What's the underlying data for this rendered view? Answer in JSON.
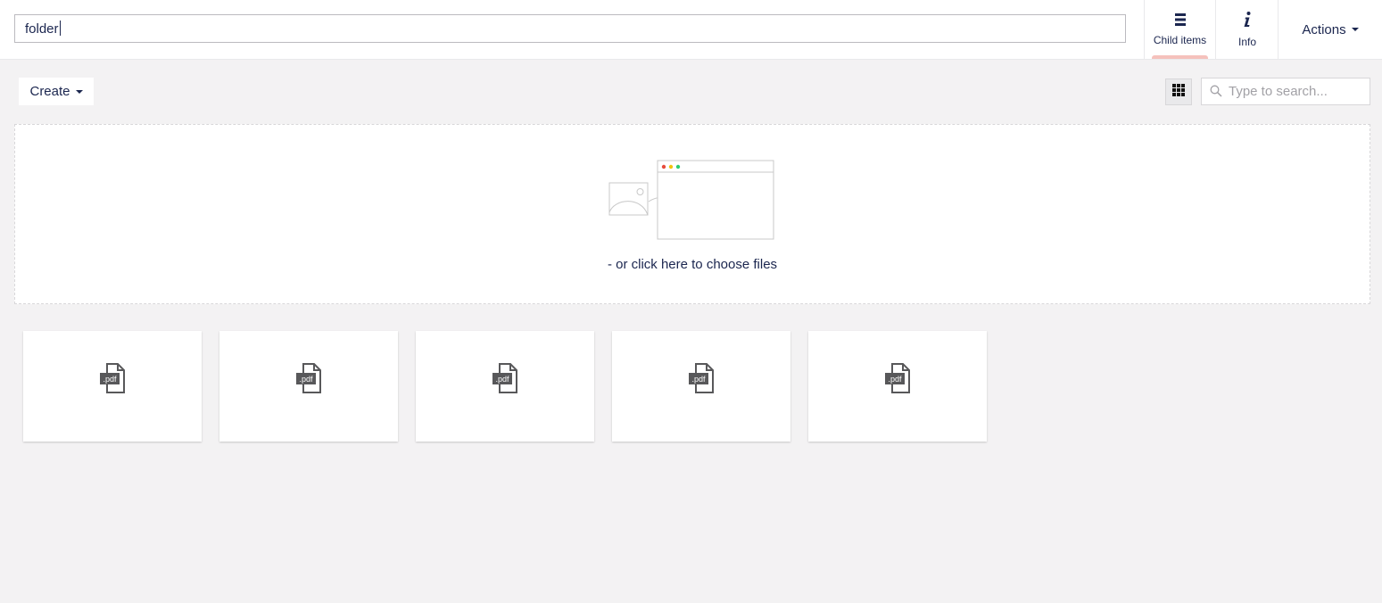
{
  "header": {
    "name_value": "folder",
    "child_items_label": "Child items",
    "info_label": "Info",
    "actions_label": "Actions"
  },
  "toolbar": {
    "create_label": "Create",
    "search_placeholder": "Type to search..."
  },
  "dropzone": {
    "text": "- or click here to choose files"
  },
  "files": [
    {
      "ext": ".pdf"
    },
    {
      "ext": ".pdf"
    },
    {
      "ext": ".pdf"
    },
    {
      "ext": ".pdf"
    },
    {
      "ext": ".pdf"
    }
  ],
  "icons": {
    "child_items": "list-icon",
    "info": "info-icon",
    "grid": "grid-view-icon",
    "search": "search-icon",
    "file": "pdf-file-icon"
  },
  "colors": {
    "active_tab": "#f5c1bc",
    "text": "#1b264f",
    "background": "#f3f2f3"
  }
}
